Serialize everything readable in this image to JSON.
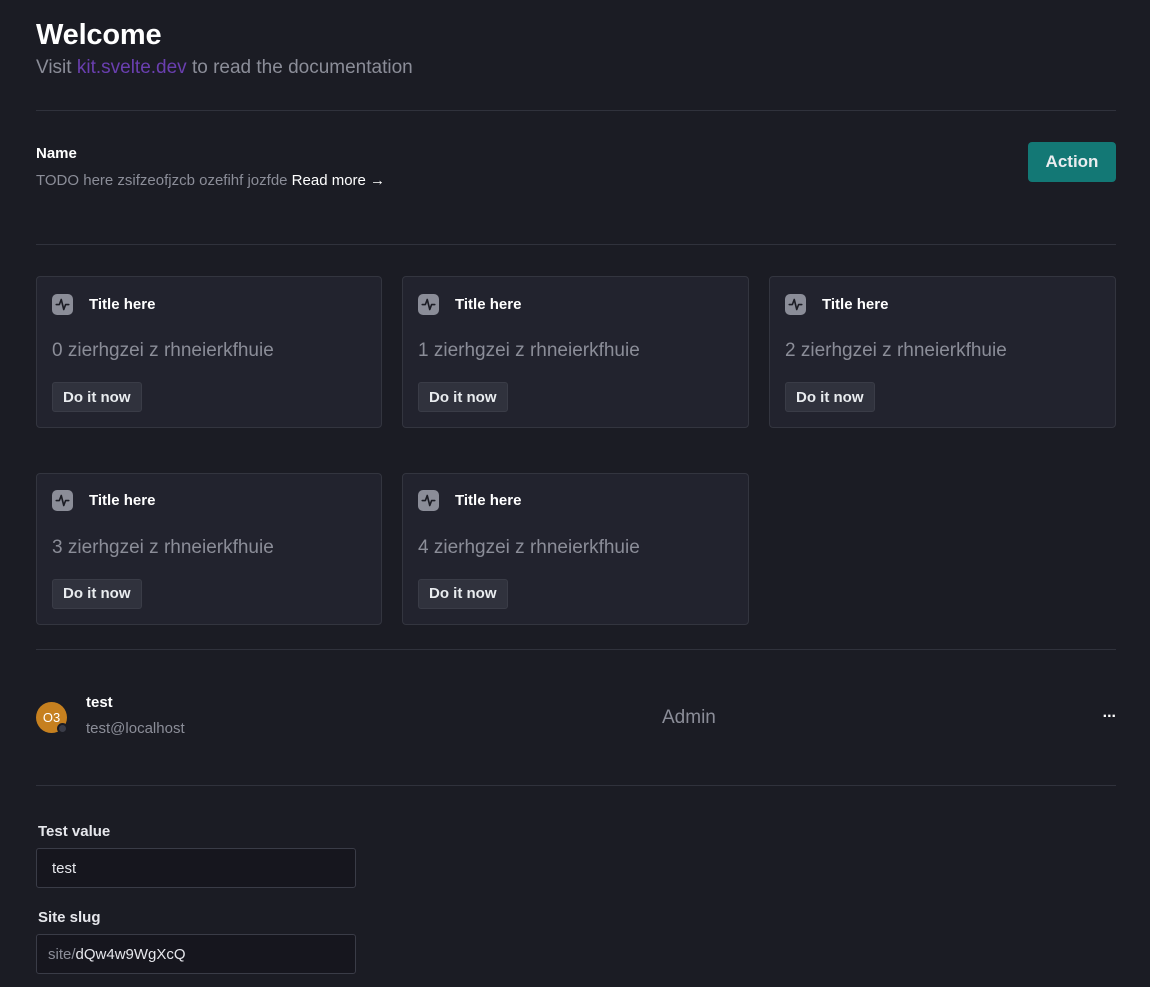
{
  "header": {
    "title": "Welcome",
    "subtitle_prefix": "Visit ",
    "subtitle_link": "kit.svelte.dev",
    "subtitle_suffix": " to read the documentation"
  },
  "section": {
    "label": "Name",
    "description": "TODO here zsifzeofjzcb ozefihf jozfde ",
    "read_more": "Read more →",
    "action_label": "Action"
  },
  "cards": [
    {
      "title": "Title here",
      "text": "0 zierhgzei z rhneierkfhuie",
      "button": "Do it now"
    },
    {
      "title": "Title here",
      "text": "1 zierhgzei z rhneierkfhuie",
      "button": "Do it now"
    },
    {
      "title": "Title here",
      "text": "2 zierhgzei z rhneierkfhuie",
      "button": "Do it now"
    },
    {
      "title": "Title here",
      "text": "3 zierhgzei z rhneierkfhuie",
      "button": "Do it now"
    },
    {
      "title": "Title here",
      "text": "4 zierhgzei z rhneierkfhuie",
      "button": "Do it now"
    }
  ],
  "card_icon": "activity-pulse-icon",
  "user": {
    "initials": "O3",
    "name": "test",
    "email": "test@localhost",
    "role": "Admin",
    "more_label": "..."
  },
  "form": {
    "test_value_label": "Test value",
    "test_value": "test",
    "site_slug_label": "Site slug",
    "site_slug_prefix": "site/",
    "site_slug_value": "dQw4w9WgXcQ"
  },
  "colors": {
    "background": "#1b1c24",
    "card_bg": "#22232e",
    "accent": "#137875",
    "link": "#6a3fb0",
    "avatar": "#c6801f",
    "muted_text": "#8b8d98"
  }
}
